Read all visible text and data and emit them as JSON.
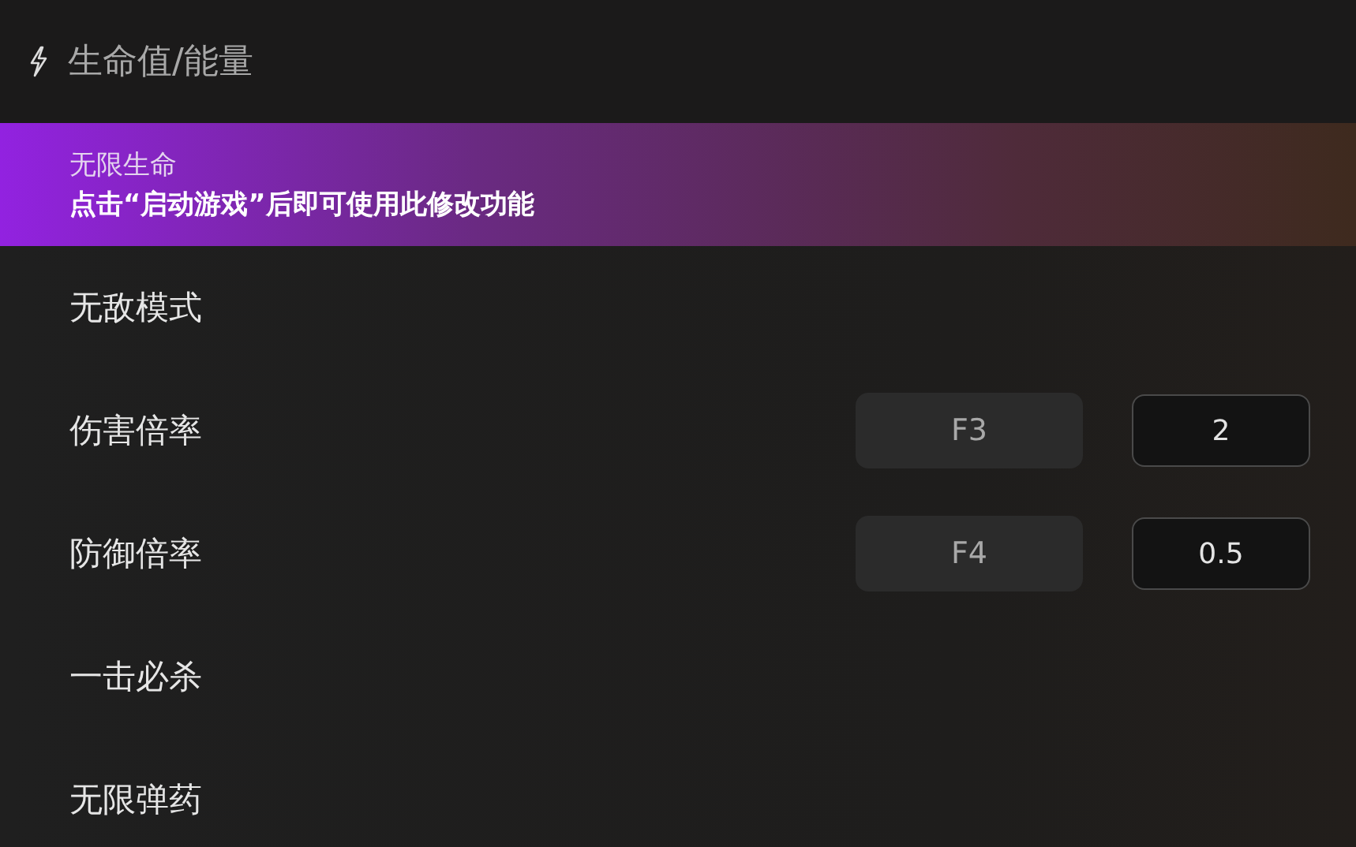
{
  "section": {
    "title": "生命值/能量"
  },
  "items": [
    {
      "kind": "toggle",
      "label": "无限生命",
      "selected": true,
      "hint": "点击“启动游戏”后即可使用此修改功能"
    },
    {
      "kind": "toggle",
      "label": "无敌模式",
      "selected": false
    },
    {
      "kind": "value",
      "label": "伤害倍率",
      "selected": false,
      "hotkey": "F3",
      "value": "2"
    },
    {
      "kind": "value",
      "label": "防御倍率",
      "selected": false,
      "hotkey": "F4",
      "value": "0.5"
    },
    {
      "kind": "toggle",
      "label": "一击必杀",
      "selected": false
    },
    {
      "kind": "toggle",
      "label": "无限弹药",
      "selected": false
    }
  ]
}
